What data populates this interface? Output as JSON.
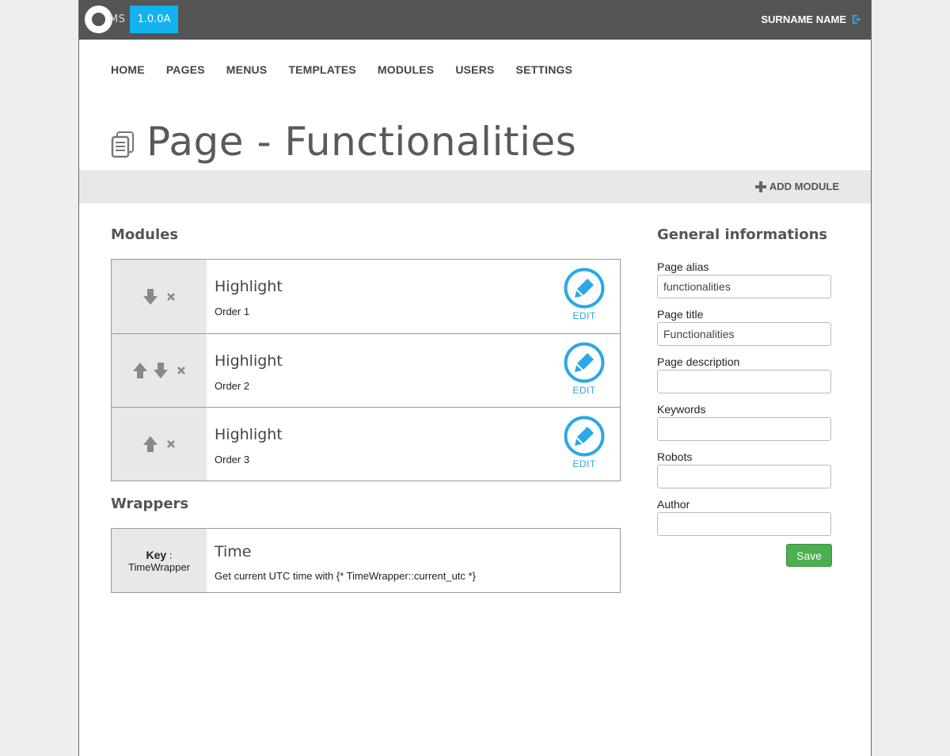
{
  "header": {
    "logo_text": "MS",
    "version": "1.0.0A",
    "user_name": "SURNAME NAME"
  },
  "nav": {
    "items": [
      {
        "label": "HOME"
      },
      {
        "label": "PAGES"
      },
      {
        "label": "MENUS"
      },
      {
        "label": "TEMPLATES"
      },
      {
        "label": "MODULES"
      },
      {
        "label": "USERS"
      },
      {
        "label": "SETTINGS"
      }
    ]
  },
  "page": {
    "title": "Page - Functionalities"
  },
  "toolbar": {
    "add_module_label": "ADD MODULE"
  },
  "modules": {
    "section_title": "Modules",
    "edit_label": "EDIT",
    "items": [
      {
        "name": "Highlight",
        "order": "Order 1"
      },
      {
        "name": "Highlight",
        "order": "Order 2"
      },
      {
        "name": "Highlight",
        "order": "Order 3"
      }
    ]
  },
  "wrappers": {
    "section_title": "Wrappers",
    "key_label": "Key",
    "key_value": "TimeWrapper",
    "name": "Time",
    "description": "Get current UTC time with {* TimeWrapper::current_utc *}"
  },
  "general": {
    "section_title": "General informations",
    "fields": {
      "alias": {
        "label": "Page alias",
        "value": "functionalities"
      },
      "title": {
        "label": "Page title",
        "value": "Functionalities"
      },
      "description": {
        "label": "Page description",
        "value": ""
      },
      "keywords": {
        "label": "Keywords",
        "value": ""
      },
      "robots": {
        "label": "Robots",
        "value": ""
      },
      "author": {
        "label": "Author",
        "value": ""
      }
    },
    "save_label": "Save"
  },
  "colors": {
    "topbar": "#555555",
    "accent": "#11b2ee",
    "edit_blue": "#2aa8e8",
    "save_green": "#4caf50"
  }
}
